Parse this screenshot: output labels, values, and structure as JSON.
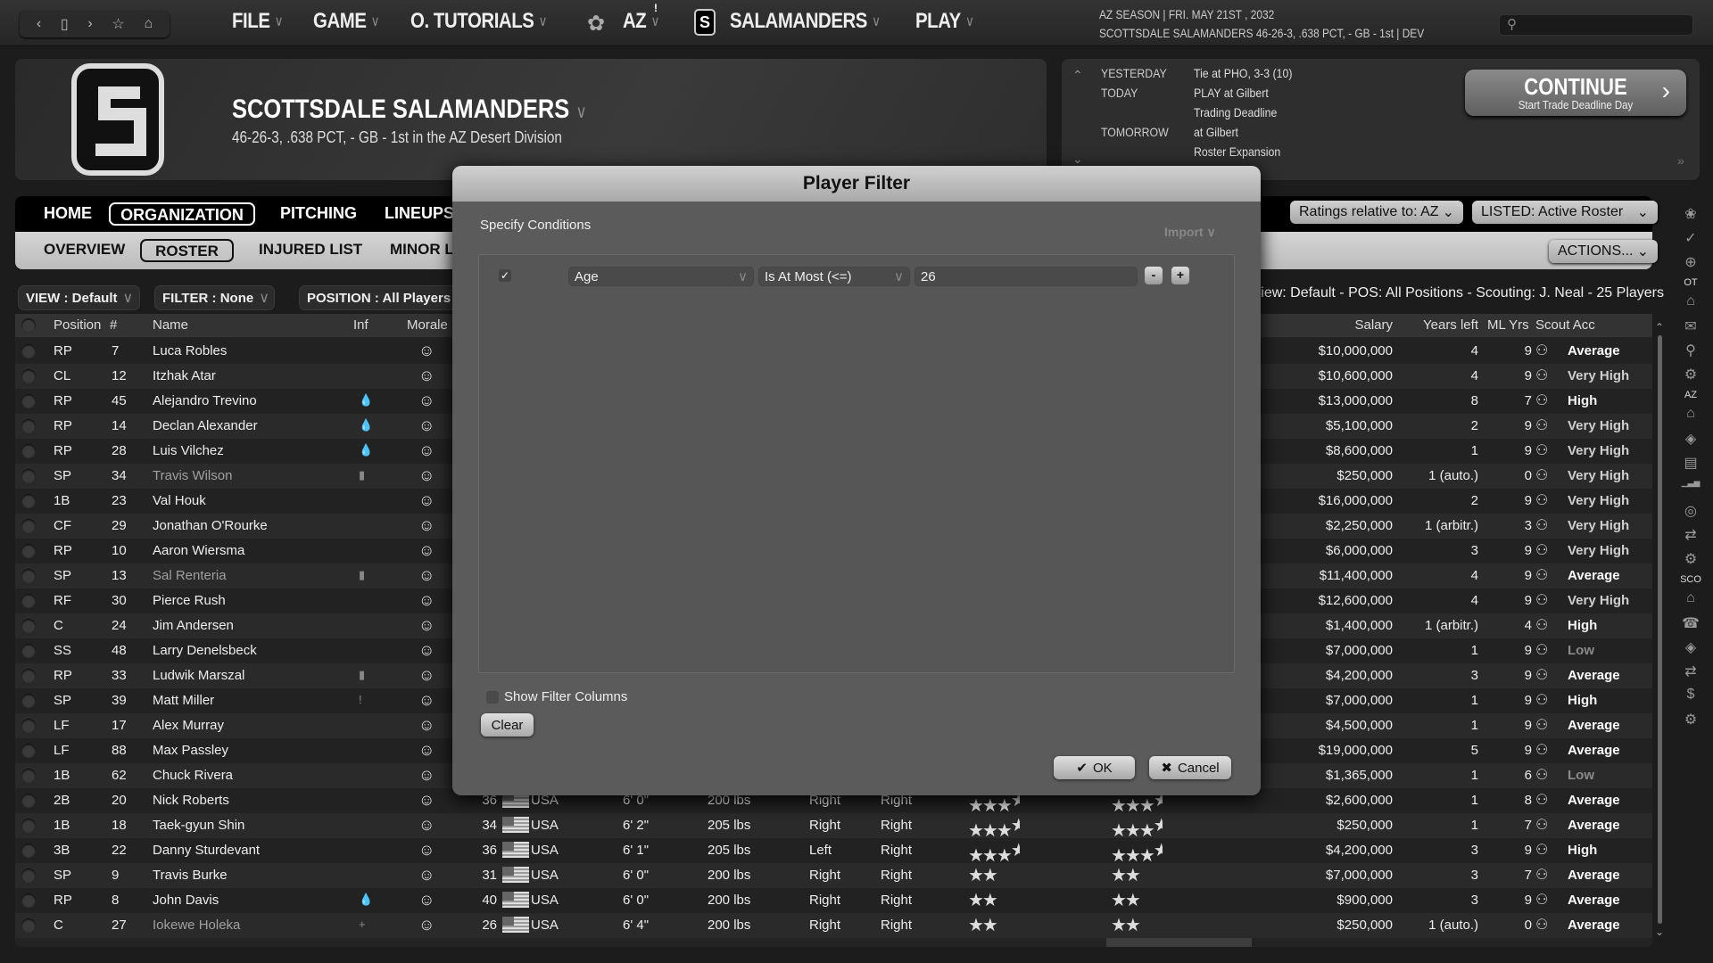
{
  "topbar": {
    "nav_icons": [
      "back-icon",
      "window-icon",
      "forward-icon",
      "star-icon",
      "home-icon"
    ],
    "menus": [
      "FILE",
      "GAME",
      "O. TUTORIALS",
      "AZ",
      "SALAMANDERS",
      "PLAY"
    ],
    "alert_badge": "!",
    "season_line1": "AZ SEASON  |  FRI. MAY 21ST , 2032",
    "season_line2": "SCOTTSDALE SALAMANDERS  46-26-3, .638 PCT, - GB - 1st | DEV",
    "search_placeholder": ""
  },
  "team": {
    "name": "SCOTTSDALE SALAMANDERS",
    "record": "46-26-3, .638 PCT, - GB - 1st in the AZ Desert Division",
    "logo_letter": "S"
  },
  "schedule": [
    {
      "label": "YESTERDAY",
      "value": "Tie at PHO, 3-3 (10)"
    },
    {
      "label": "TODAY",
      "value": "PLAY at Gilbert"
    },
    {
      "label": "",
      "value": "Trading Deadline"
    },
    {
      "label": "TOMORROW",
      "value": "at Gilbert"
    },
    {
      "label": "",
      "value": "Roster Expansion"
    }
  ],
  "continue": {
    "label": "CONTINUE",
    "sub": "Start Trade Deadline Day"
  },
  "tabs": [
    "HOME",
    "ORGANIZATION",
    "PITCHING",
    "LINEUPS"
  ],
  "active_tab": "ORGANIZATION",
  "subtabs": [
    "OVERVIEW",
    "ROSTER",
    "INJURED LIST",
    "MINOR L"
  ],
  "active_subtab": "ROSTER",
  "controls": {
    "ratings": "Ratings relative to: AZ",
    "listed": "LISTED: Active Roster",
    "actions": "ACTIONS...",
    "view": "VIEW : Default",
    "filter": "FILTER : None",
    "position": "POSITION : All Players",
    "view_info": "View: Default - POS: All Positions - Scouting: J. Neal - 25 Players"
  },
  "columns": {
    "position": "Position",
    "num": "#",
    "name": "Name",
    "inf": "Inf",
    "morale": "Morale",
    "salary": "Salary",
    "years_left": "Years left",
    "ml_yrs": "ML Yrs",
    "scout_acc": "Scout Acc"
  },
  "players": [
    {
      "pos": "RP",
      "num": "7",
      "name": "Luca Robles",
      "inf": "",
      "morale": "grin",
      "salary": "$10,000,000",
      "yl": "4",
      "ml": "9",
      "acc": "Average"
    },
    {
      "pos": "CL",
      "num": "12",
      "name": "Itzhak Atar",
      "inf": "",
      "morale": "grin",
      "salary": "$10,600,000",
      "yl": "4",
      "ml": "9",
      "acc": "Very High"
    },
    {
      "pos": "RP",
      "num": "45",
      "name": "Alejandro Trevino",
      "inf": "flame",
      "morale": "grin",
      "salary": "$13,000,000",
      "yl": "8",
      "ml": "7",
      "acc": "High"
    },
    {
      "pos": "RP",
      "num": "14",
      "name": "Declan Alexander",
      "inf": "flame",
      "morale": "smile",
      "salary": "$5,100,000",
      "yl": "2",
      "ml": "9",
      "acc": "Very High"
    },
    {
      "pos": "RP",
      "num": "28",
      "name": "Luis Vilchez",
      "inf": "flame",
      "morale": "grin",
      "salary": "$8,600,000",
      "yl": "1",
      "ml": "9",
      "acc": "Very High"
    },
    {
      "pos": "SP",
      "num": "34",
      "name": "Travis Wilson",
      "dim": true,
      "inf": "bar",
      "morale": "grin",
      "salary": "$250,000",
      "yl": "1 (auto.)",
      "ml": "0",
      "acc": "Very High"
    },
    {
      "pos": "1B",
      "num": "23",
      "name": "Val Houk",
      "inf": "",
      "morale": "grin",
      "salary": "$16,000,000",
      "yl": "2",
      "ml": "9",
      "acc": "Very High"
    },
    {
      "pos": "CF",
      "num": "29",
      "name": "Jonathan O'Rourke",
      "inf": "",
      "morale": "grin",
      "salary": "$2,250,000",
      "yl": "1 (arbitr.)",
      "ml": "3",
      "acc": "Very High"
    },
    {
      "pos": "RP",
      "num": "10",
      "name": "Aaron Wiersma",
      "inf": "",
      "morale": "smile",
      "salary": "$6,000,000",
      "yl": "3",
      "ml": "9",
      "acc": "Very High"
    },
    {
      "pos": "SP",
      "num": "13",
      "name": "Sal Renteria",
      "dim": true,
      "inf": "bar",
      "morale": "grin",
      "salary": "$11,400,000",
      "yl": "4",
      "ml": "9",
      "acc": "Average"
    },
    {
      "pos": "RF",
      "num": "30",
      "name": "Pierce Rush",
      "inf": "",
      "morale": "grin",
      "salary": "$12,600,000",
      "yl": "4",
      "ml": "9",
      "acc": "Very High"
    },
    {
      "pos": "C",
      "num": "24",
      "name": "Jim Andersen",
      "inf": "",
      "morale": "grin",
      "salary": "$1,400,000",
      "yl": "1 (arbitr.)",
      "ml": "4",
      "acc": "High"
    },
    {
      "pos": "SS",
      "num": "48",
      "name": "Larry Denelsbeck",
      "inf": "",
      "morale": "grin",
      "salary": "$7,000,000",
      "yl": "1",
      "ml": "9",
      "acc": "Low"
    },
    {
      "pos": "RP",
      "num": "33",
      "name": "Ludwik Marszal",
      "inf": "bar",
      "morale": "grin",
      "salary": "$4,200,000",
      "yl": "3",
      "ml": "9",
      "acc": "Average"
    },
    {
      "pos": "SP",
      "num": "39",
      "name": "Matt Miller",
      "inf": "exclaim",
      "morale": "grin",
      "salary": "$7,000,000",
      "yl": "1",
      "ml": "9",
      "acc": "High"
    },
    {
      "pos": "LF",
      "num": "17",
      "name": "Alex Murray",
      "inf": "",
      "morale": "grin",
      "salary": "$4,500,000",
      "yl": "1",
      "ml": "9",
      "acc": "Average"
    },
    {
      "pos": "LF",
      "num": "88",
      "name": "Max Passley",
      "inf": "",
      "morale": "grin",
      "salary": "$19,000,000",
      "yl": "5",
      "ml": "9",
      "acc": "Average"
    },
    {
      "pos": "1B",
      "num": "62",
      "name": "Chuck Rivera",
      "inf": "",
      "morale": "grin",
      "salary": "$1,365,000",
      "yl": "1",
      "ml": "6",
      "acc": "Low"
    },
    {
      "pos": "2B",
      "num": "20",
      "name": "Nick Roberts",
      "inf": "",
      "morale": "grin",
      "age": "36",
      "nat": "USA",
      "ht": "6' 0\"",
      "wt": "200 lbs",
      "bats": "Right",
      "throws": "Right",
      "cur": 3.5,
      "pot": 3.5,
      "salary": "$2,600,000",
      "yl": "1",
      "ml": "8",
      "acc": "Average"
    },
    {
      "pos": "1B",
      "num": "18",
      "name": "Taek-gyun Shin",
      "inf": "",
      "morale": "grin",
      "age": "34",
      "nat": "USA",
      "ht": "6' 2\"",
      "wt": "205 lbs",
      "bats": "Right",
      "throws": "Right",
      "cur": 3.5,
      "pot": 3.5,
      "salary": "$250,000",
      "yl": "1",
      "ml": "7",
      "acc": "Average"
    },
    {
      "pos": "3B",
      "num": "22",
      "name": "Danny Sturdevant",
      "inf": "",
      "morale": "grin",
      "age": "36",
      "nat": "USA",
      "ht": "6' 1\"",
      "wt": "205 lbs",
      "bats": "Left",
      "throws": "Right",
      "cur": 3.5,
      "pot": 3.5,
      "salary": "$4,200,000",
      "yl": "3",
      "ml": "9",
      "acc": "High"
    },
    {
      "pos": "SP",
      "num": "9",
      "name": "Travis Burke",
      "inf": "",
      "morale": "smile",
      "age": "31",
      "nat": "USA",
      "ht": "6' 0\"",
      "wt": "200 lbs",
      "bats": "Right",
      "throws": "Right",
      "cur": 2,
      "pot": 2,
      "salary": "$7,000,000",
      "yl": "3",
      "ml": "7",
      "acc": "Average"
    },
    {
      "pos": "RP",
      "num": "8",
      "name": "John Davis",
      "inf": "flame",
      "morale": "grin",
      "age": "40",
      "nat": "USA",
      "ht": "6' 0\"",
      "wt": "200 lbs",
      "bats": "Right",
      "throws": "Right",
      "cur": 2,
      "pot": 2,
      "salary": "$900,000",
      "yl": "3",
      "ml": "9",
      "acc": "Average"
    },
    {
      "pos": "C",
      "num": "27",
      "name": "Iokewe Holeka",
      "dim": true,
      "inf": "plus",
      "morale": "grin",
      "age": "26",
      "nat": "USA",
      "ht": "6' 4\"",
      "wt": "200 lbs",
      "bats": "Right",
      "throws": "Right",
      "cur": 2,
      "pot": 2,
      "salary": "$250,000",
      "yl": "1 (auto.)",
      "ml": "0",
      "acc": "Average"
    }
  ],
  "acc_colors": {
    "Average": "#ffffff",
    "Very High": "#cfcfcf",
    "High": "#f2f2f2",
    "Low": "#8a8a8a"
  },
  "sidebar": {
    "groups": [
      {
        "label": "",
        "icons": [
          "lightbulb-icon",
          "check-icon",
          "globe-icon"
        ]
      },
      {
        "label": "OT",
        "icons": [
          "home-icon",
          "mail-icon",
          "search-icon",
          "gear-icon"
        ]
      },
      {
        "label": "AZ",
        "icons": [
          "home-icon",
          "eye-icon",
          "id-card-icon",
          "bar-chart-icon",
          "baseball-icon",
          "trade-icon",
          "gear-icon"
        ]
      },
      {
        "label": "SCO",
        "icons": [
          "home-icon",
          "scout-icon",
          "eye-icon",
          "trade-icon",
          "dollar-icon",
          "gear-icon"
        ]
      }
    ]
  },
  "modal": {
    "title": "Player Filter",
    "specify": "Specify Conditions",
    "import": "Import",
    "condition": {
      "checked": true,
      "field": "Age",
      "operator": "Is At Most (<=)",
      "value": "26"
    },
    "minus": "-",
    "plus": "+",
    "show_filter_columns": "Show Filter Columns",
    "show_filter_checked": false,
    "clear": "Clear",
    "ok": "OK",
    "cancel": "Cancel"
  }
}
